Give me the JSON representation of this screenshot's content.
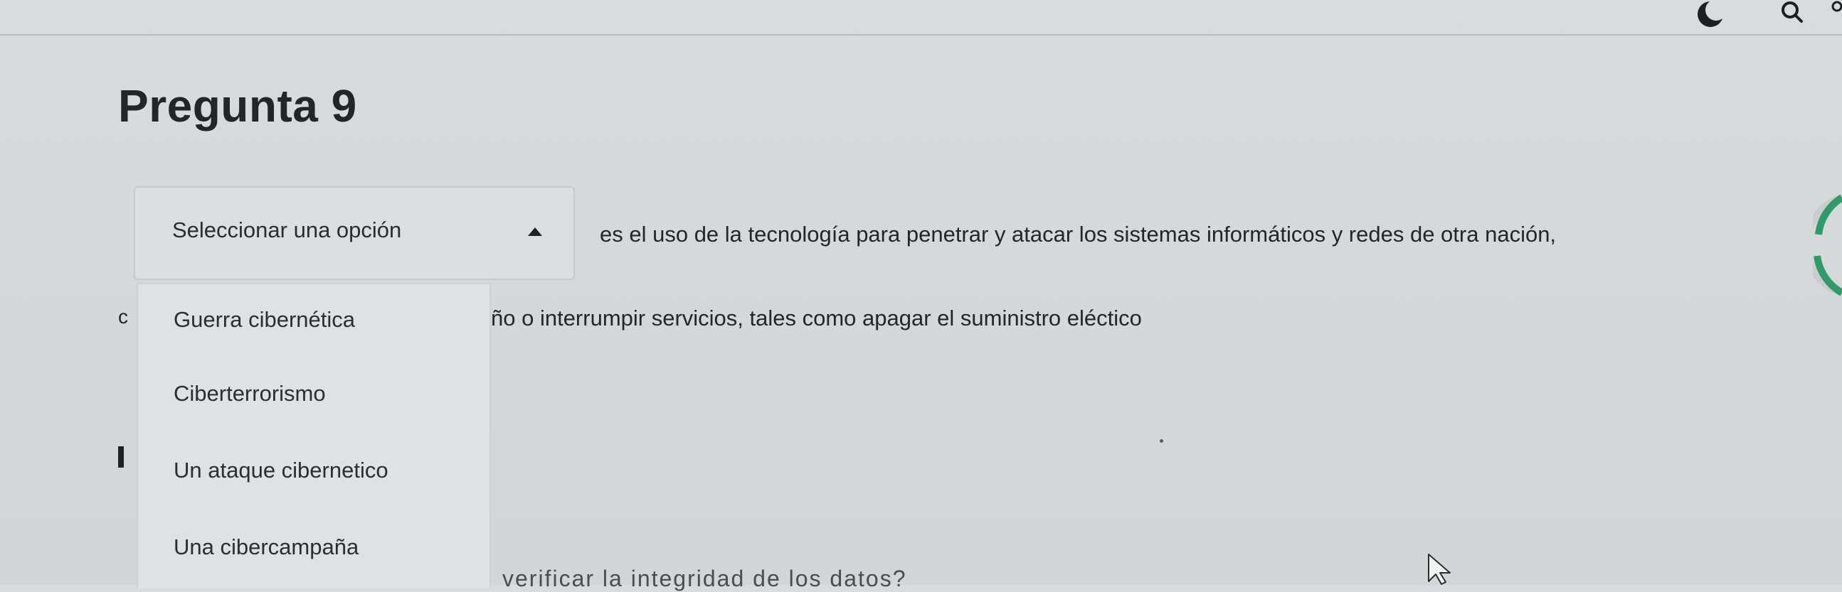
{
  "question": {
    "title": "Pregunta 9",
    "select_placeholder": "Seleccionar una opción",
    "text_line1": "es el uso de la tecnología para penetrar y atacar los sistemas informáticos y redes de otra nación,",
    "text_line2": "ño o interrumpir servicios, tales como apagar el suministro eléctico",
    "partial_letter": "c",
    "cut_text": "verificar la integridad de los datos?"
  },
  "dropdown": {
    "options": [
      "Guerra cibernética",
      "Ciberterrorismo",
      "Un ataque cibernetico",
      "Una cibercampaña"
    ]
  },
  "icons": {
    "moon": "moon-icon",
    "search": "search-icon",
    "caret": "caret-up-icon",
    "pointer": "mouse-pointer-icon",
    "side": "circular-progress-icon"
  },
  "colors": {
    "background": "#d6d9da",
    "panel": "#dfe2e3",
    "text": "#232628",
    "accent_green": "#2f9a6a"
  }
}
